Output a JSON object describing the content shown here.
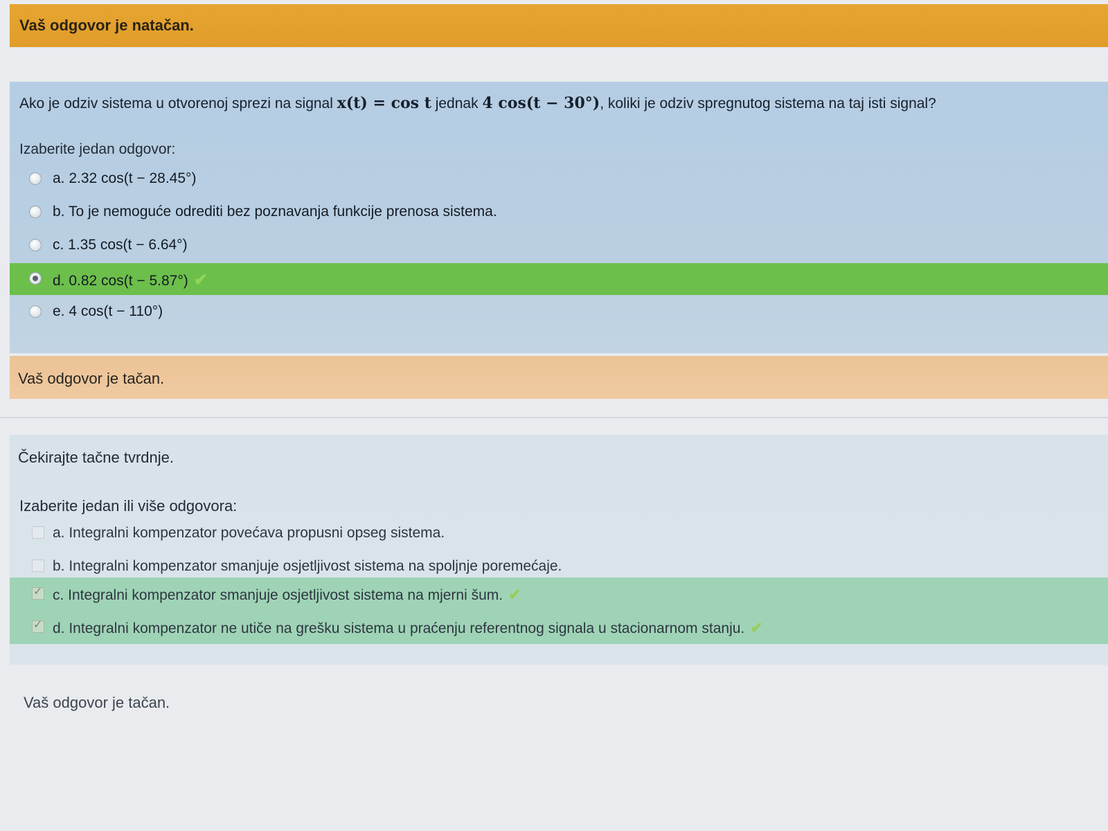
{
  "feedback_top": "Vaš odgovor je natačan.",
  "question1": {
    "text_before": "Ako je odziv sistema u otvorenoj sprezi na signal ",
    "signal_math": "x(t) = cos t",
    "text_middle": " jednak ",
    "response_math": "4 cos(t − 30°)",
    "text_after": ", koliki je odziv spregnutog sistema na taj isti signal?",
    "prompt": "Izaberite jedan odgovor:",
    "options": [
      {
        "label": "a. 2.32 cos(t − 28.45°)",
        "selected": false,
        "correct": false
      },
      {
        "label": "b. To je nemoguće odrediti bez poznavanja funkcije prenosa sistema.",
        "selected": false,
        "correct": false
      },
      {
        "label": "c. 1.35 cos(t − 6.64°)",
        "selected": false,
        "correct": false
      },
      {
        "label": "d. 0.82 cos(t − 5.87°)",
        "selected": true,
        "correct": true
      },
      {
        "label": "e. 4 cos(t − 110°)",
        "selected": false,
        "correct": false
      }
    ],
    "tick_glyph": "✔"
  },
  "feedback_mid": "Vaš odgovor je tačan.",
  "question2": {
    "text": "Čekirajte tačne tvrdnje.",
    "prompt": "Izaberite jedan ili više odgovora:",
    "options": [
      {
        "label": "a. Integralni kompenzator povećava propusni opseg sistema.",
        "checked": false,
        "correct": false
      },
      {
        "label": "b. Integralni kompenzator smanjuje osjetljivost sistema na spoljnje poremećaje.",
        "checked": false,
        "correct": false
      },
      {
        "label": "c. Integralni kompenzator smanjuje osjetljivost sistema na mjerni šum.",
        "checked": true,
        "correct": true
      },
      {
        "label": "d. Integralni kompenzator ne utiče na grešku sistema u praćenju referentnog signala u stacionarnom stanju.",
        "checked": true,
        "correct": true
      }
    ],
    "tick_glyph": "✔"
  },
  "feedback_bottom": "Vaš odgovor je tačan.",
  "colors": {
    "feedback_orange": "#e6a531",
    "question_blue": "#b5cde3",
    "correct_green": "#6cbf4b",
    "feedback_peach": "#ecc395",
    "correct_mint": "#9fd3b6"
  }
}
